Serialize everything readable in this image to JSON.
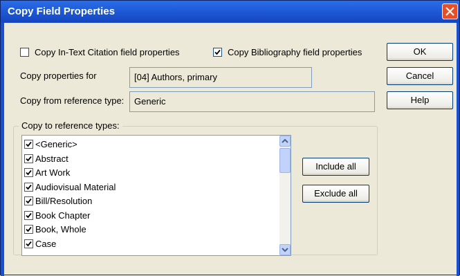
{
  "window": {
    "title": "Copy Field Properties"
  },
  "options": {
    "intext_label": "Copy In-Text Citation field properties",
    "intext_checked": false,
    "biblio_label": "Copy Bibliography field properties",
    "biblio_checked": true
  },
  "fields": {
    "copy_for_label": "Copy properties for",
    "copy_for_value": "[04] Authors, primary",
    "copy_from_label": "Copy from reference type:",
    "copy_from_value": "Generic"
  },
  "buttons": {
    "ok": "OK",
    "cancel": "Cancel",
    "help": "Help",
    "include_all": "Include all",
    "exclude_all": "Exclude all"
  },
  "group": {
    "title": "Copy to reference types:"
  },
  "reference_types": [
    {
      "label": "<Generic>",
      "checked": true
    },
    {
      "label": "Abstract",
      "checked": true
    },
    {
      "label": "Art Work",
      "checked": true
    },
    {
      "label": "Audiovisual Material",
      "checked": true
    },
    {
      "label": "Bill/Resolution",
      "checked": true
    },
    {
      "label": "Book Chapter",
      "checked": true
    },
    {
      "label": "Book, Whole",
      "checked": true
    },
    {
      "label": "Case",
      "checked": true
    }
  ],
  "icons": {
    "close": "close-icon",
    "check": "checkmark-icon",
    "scroll_up": "arrow-up-icon",
    "scroll_down": "arrow-down-icon"
  },
  "colors": {
    "titlebar": "#1f5ad6",
    "dialog_bg": "#ece9d8",
    "close_button": "#e0512c"
  }
}
